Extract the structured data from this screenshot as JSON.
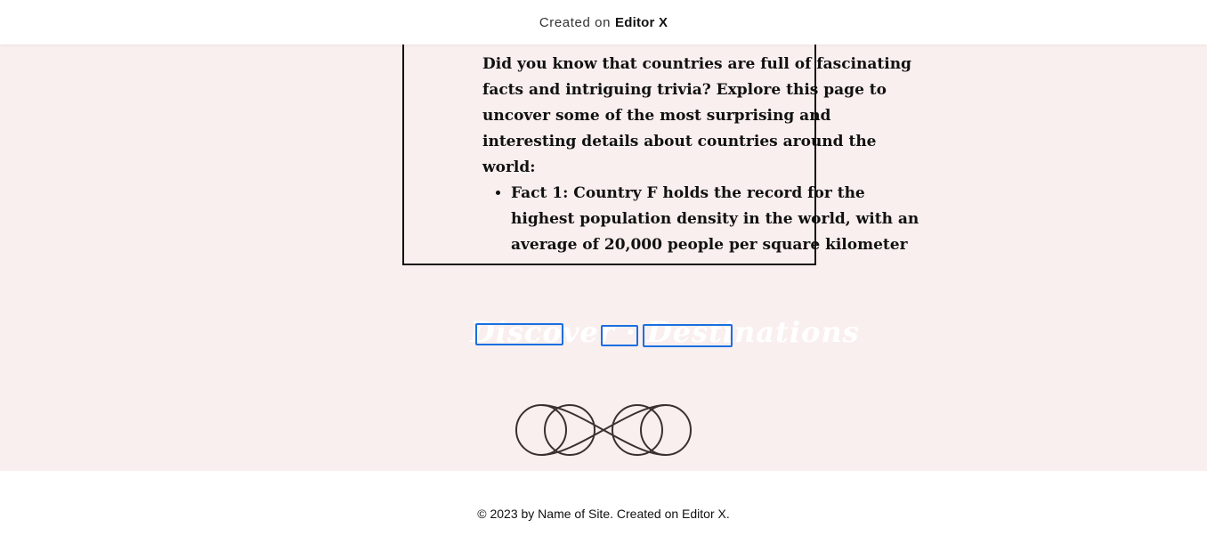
{
  "banner": {
    "prefix": "Created on",
    "brand": "Editor X"
  },
  "content": {
    "intro": "Did you know that countries are full of fascinating facts and intriguing trivia? Explore this page to uncover some of the most surprising and interesting details about countries around the world:",
    "facts": [
      "Fact 1: Country F holds the record for the highest population density in the world, with an average of 20,000 people per square kilometer"
    ],
    "ghost_title": "Discover · Destinations"
  },
  "ornament": {
    "icon": "infinity-knot-icon"
  },
  "footer": {
    "text": "© 2023 by Name of Site. Created on Editor X."
  },
  "colors": {
    "background_pink": "#f9efee",
    "text_dark": "#111111",
    "focus_blue": "#1a6fe0",
    "ornament_stroke": "#3a3030"
  }
}
